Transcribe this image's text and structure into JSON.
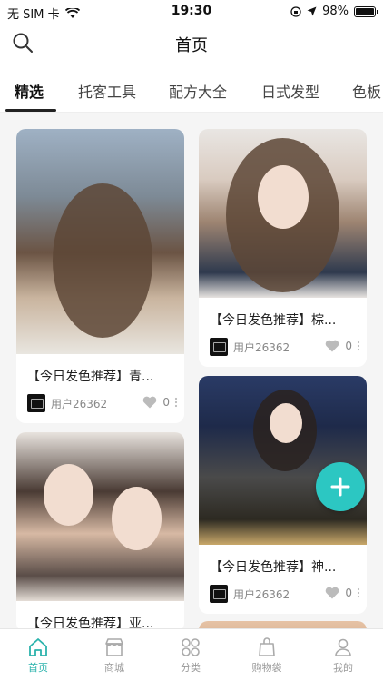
{
  "status_bar": {
    "carrier": "无 SIM 卡",
    "time": "19:30",
    "battery": "98%",
    "battery_level": 0.98
  },
  "header": {
    "title": "首页",
    "search_icon": "search-icon"
  },
  "tabs": [
    {
      "label": "精选",
      "active": true
    },
    {
      "label": "托客工具",
      "active": false
    },
    {
      "label": "配方大全",
      "active": false
    },
    {
      "label": "日式发型",
      "active": false
    },
    {
      "label": "色板",
      "active": false
    }
  ],
  "cards": [
    {
      "title": "【今日发色推荐】青...",
      "user": "用户26362",
      "likes": "0"
    },
    {
      "title": "【今日发色推荐】棕...",
      "user": "用户26362",
      "likes": "0"
    },
    {
      "title": "【今日发色推荐】神...",
      "user": "用户26362",
      "likes": "0"
    },
    {
      "title": "【今日发色推荐】亚...",
      "user": "",
      "likes": ""
    }
  ],
  "bottom_nav": [
    {
      "label": "首页",
      "icon": "home-icon",
      "active": true
    },
    {
      "label": "商城",
      "icon": "store-icon",
      "active": false
    },
    {
      "label": "分类",
      "icon": "category-icon",
      "active": false
    },
    {
      "label": "购物袋",
      "icon": "shopping-bag-icon",
      "active": false
    },
    {
      "label": "我的",
      "icon": "profile-icon",
      "active": false
    }
  ],
  "colors": {
    "accent": "#2cc7c2",
    "active_nav": "#2bb3ac"
  }
}
